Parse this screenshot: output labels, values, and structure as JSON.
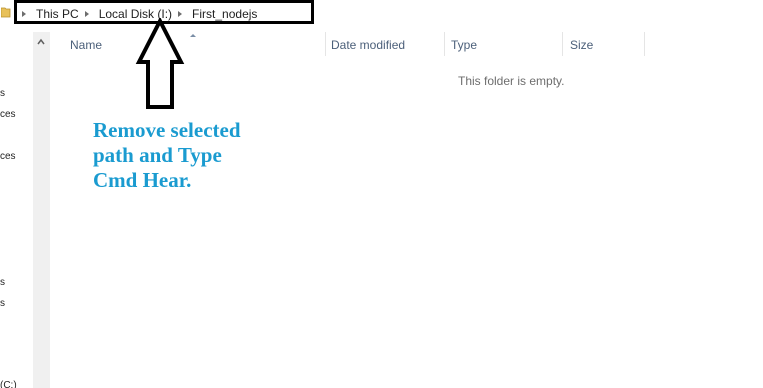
{
  "address_bar": {
    "crumbs": [
      "This PC",
      "Local Disk (I:)",
      "First_nodejs"
    ]
  },
  "nav_pane": {
    "fragments": [
      "s",
      "ces",
      "ces",
      "s",
      "s",
      "(C:)"
    ]
  },
  "columns": [
    "Name",
    "Date modified",
    "Type",
    "Size"
  ],
  "empty_message": "This folder is empty.",
  "annotation": {
    "lines": [
      "Remove selected",
      "path and Type",
      "Cmd Hear."
    ],
    "color": "#1a9bd0"
  },
  "icons": [
    "folder-icon",
    "chevron-right-icon",
    "scroll-up-arrow-icon",
    "sort-ascending-icon",
    "up-arrow-annotation-icon"
  ]
}
